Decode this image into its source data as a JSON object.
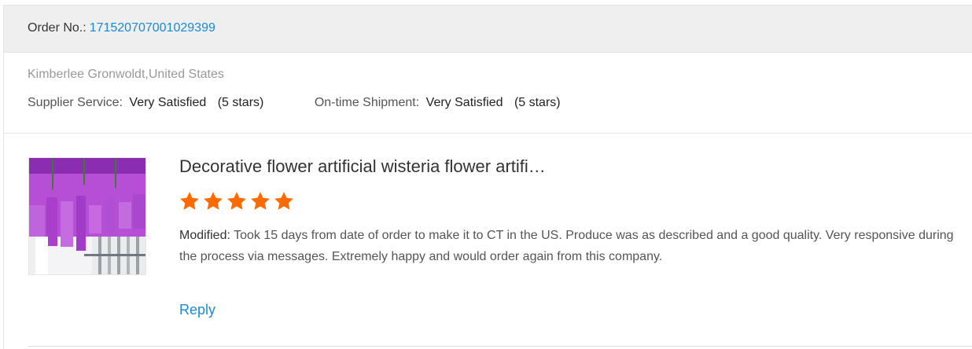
{
  "order": {
    "label": "Order No.:",
    "number": "171520707001029399"
  },
  "reviewer": {
    "name_location": "Kimberlee Gronwoldt,United States"
  },
  "ratings": [
    {
      "label": "Supplier Service:",
      "value": "Very Satisfied",
      "stars_text": "(5 stars)"
    },
    {
      "label": "On-time Shipment:",
      "value": "Very Satisfied",
      "stars_text": "(5 stars)"
    }
  ],
  "product": {
    "title": "Decorative flower artificial wisteria flower artifi…",
    "rating": 5,
    "rating_max": 5,
    "star_color": "#ff6a00",
    "comment_label": "Modified:",
    "comment": "Took 15 days from date of order to make it to CT in the US.  Produce was as described and a good quality.  Very responsive during the process via messages.  Extremely happy and would order again from this company."
  },
  "actions": {
    "reply_label": "Reply"
  },
  "colors": {
    "link": "#1a8ad4",
    "header_bg": "#efefef"
  }
}
